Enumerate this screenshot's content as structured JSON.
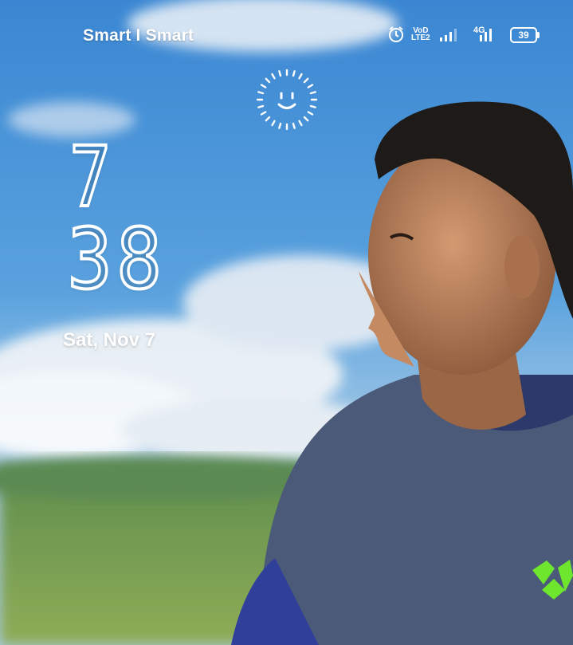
{
  "status_bar": {
    "carrier": "Smart I Smart",
    "volte_label_top": "VoD",
    "volte_label_bottom": "LTE2",
    "network_type": "4G",
    "battery_level": "39",
    "icons": [
      "alarm-icon",
      "volte-icon",
      "signal-icon",
      "signal-4g-icon",
      "battery-icon"
    ]
  },
  "lock_screen": {
    "face_unlock_icon": "face-unlock-icon",
    "clock_hour": "7",
    "clock_minute": "38",
    "date": "Sat, Nov 7"
  },
  "colors": {
    "sky_top": "#3f8fd6",
    "sky_bottom": "#8fc0e8",
    "hills": "#6f9a55",
    "shirt": "#4d5b78",
    "logo_green": "#6ee62e"
  }
}
